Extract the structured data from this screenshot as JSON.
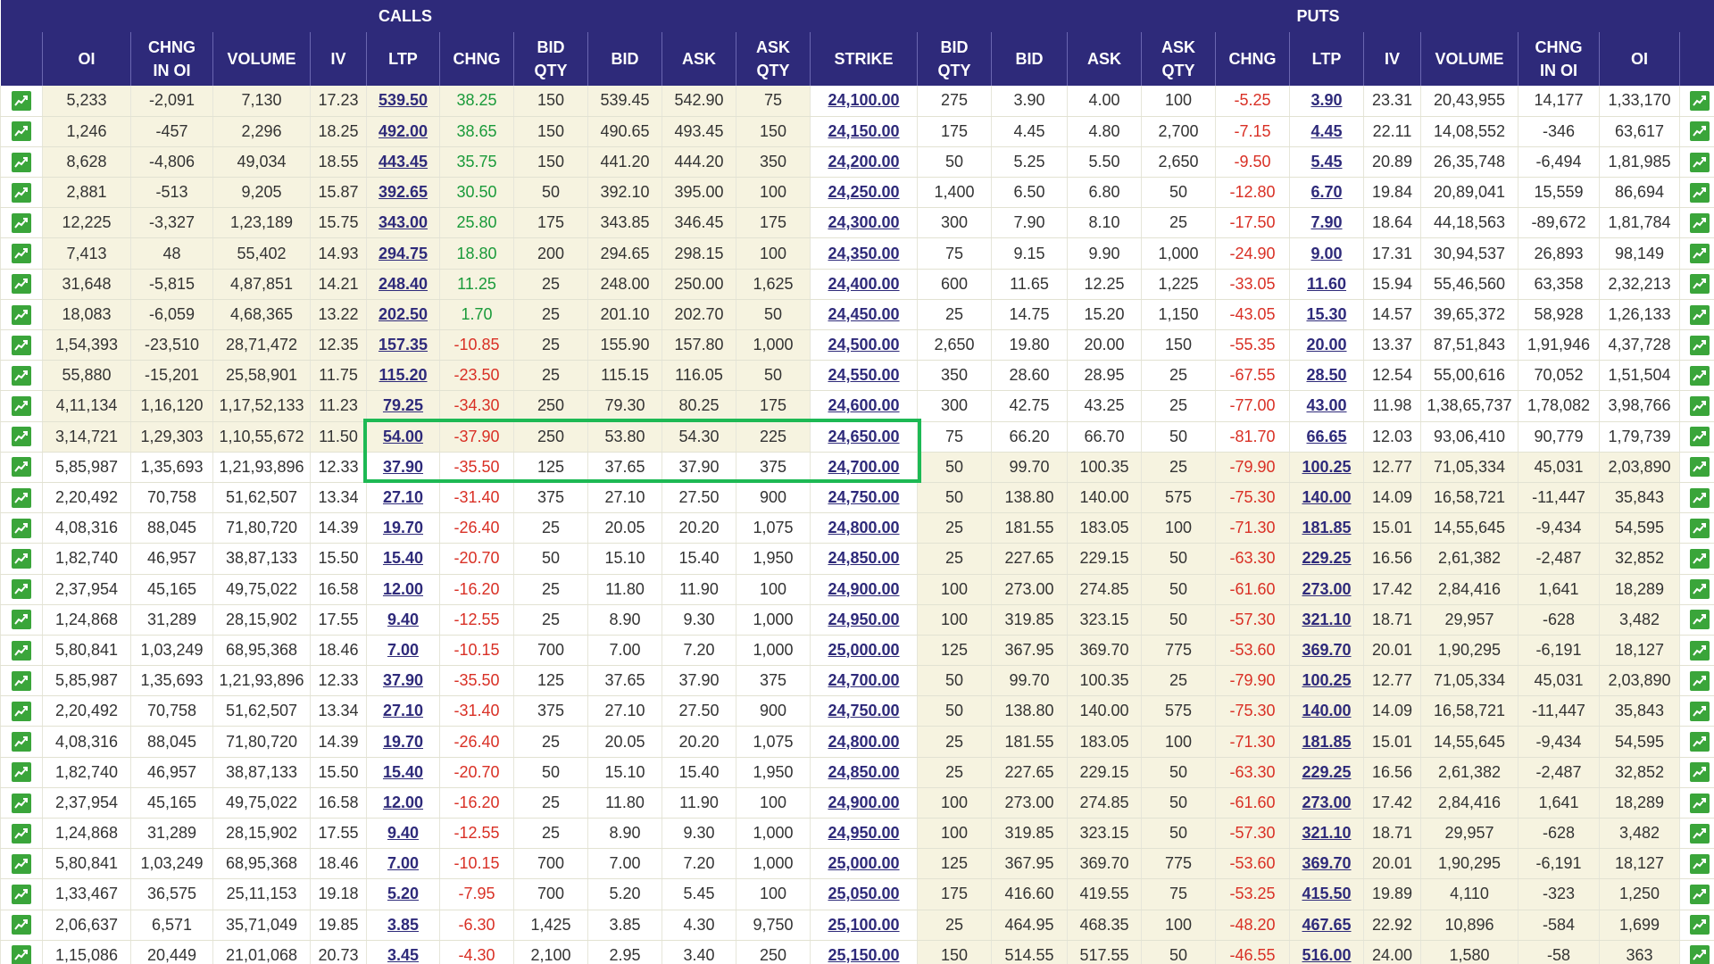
{
  "header": {
    "calls_label": "CALLS",
    "puts_label": "PUTS",
    "columns": {
      "oi": "OI",
      "chng_in_oi_1": "CHNG",
      "chng_in_oi_2": "IN OI",
      "volume": "VOLUME",
      "iv": "IV",
      "ltp": "LTP",
      "chng": "CHNG",
      "bid_qty_1": "BID",
      "bid_qty_2": "QTY",
      "bid": "BID",
      "ask": "ASK",
      "ask_qty_1": "ASK",
      "ask_qty_2": "QTY",
      "strike": "STRIKE"
    }
  },
  "icons": {
    "chart": "line-chart-icon"
  },
  "colors": {
    "header_bg": "#2e2a7a",
    "itm_bg": "#f6f3e0",
    "positive": "#1a9a3a",
    "negative": "#d93025",
    "highlight": "#1db954",
    "chart_btn": "#3aa53a"
  },
  "highlight": {
    "description": "green rectangle around rows at strikes 24,650.00 and 24,700.00"
  },
  "rows": [
    {
      "c_oi": "5,233",
      "c_chngoi": "-2,091",
      "c_vol": "7,130",
      "c_iv": "17.23",
      "c_ltp": "539.50",
      "c_chng": "38.25",
      "c_bqty": "150",
      "c_bid": "539.45",
      "c_ask": "542.90",
      "c_aqty": "75",
      "strike": "24,100.00",
      "p_bqty": "275",
      "p_bid": "3.90",
      "p_ask": "4.00",
      "p_aqty": "100",
      "p_chng": "-5.25",
      "p_ltp": "3.90",
      "p_iv": "23.31",
      "p_vol": "20,43,955",
      "p_chngoi": "14,177",
      "p_oi": "1,33,170",
      "call_itm": true
    },
    {
      "c_oi": "1,246",
      "c_chngoi": "-457",
      "c_vol": "2,296",
      "c_iv": "18.25",
      "c_ltp": "492.00",
      "c_chng": "38.65",
      "c_bqty": "150",
      "c_bid": "490.65",
      "c_ask": "493.45",
      "c_aqty": "150",
      "strike": "24,150.00",
      "p_bqty": "175",
      "p_bid": "4.45",
      "p_ask": "4.80",
      "p_aqty": "2,700",
      "p_chng": "-7.15",
      "p_ltp": "4.45",
      "p_iv": "22.11",
      "p_vol": "14,08,552",
      "p_chngoi": "-346",
      "p_oi": "63,617",
      "call_itm": true
    },
    {
      "c_oi": "8,628",
      "c_chngoi": "-4,806",
      "c_vol": "49,034",
      "c_iv": "18.55",
      "c_ltp": "443.45",
      "c_chng": "35.75",
      "c_bqty": "150",
      "c_bid": "441.20",
      "c_ask": "444.20",
      "c_aqty": "350",
      "strike": "24,200.00",
      "p_bqty": "50",
      "p_bid": "5.25",
      "p_ask": "5.50",
      "p_aqty": "2,650",
      "p_chng": "-9.50",
      "p_ltp": "5.45",
      "p_iv": "20.89",
      "p_vol": "26,35,748",
      "p_chngoi": "-6,494",
      "p_oi": "1,81,985",
      "call_itm": true
    },
    {
      "c_oi": "2,881",
      "c_chngoi": "-513",
      "c_vol": "9,205",
      "c_iv": "15.87",
      "c_ltp": "392.65",
      "c_chng": "30.50",
      "c_bqty": "50",
      "c_bid": "392.10",
      "c_ask": "395.00",
      "c_aqty": "100",
      "strike": "24,250.00",
      "p_bqty": "1,400",
      "p_bid": "6.50",
      "p_ask": "6.80",
      "p_aqty": "50",
      "p_chng": "-12.80",
      "p_ltp": "6.70",
      "p_iv": "19.84",
      "p_vol": "20,89,041",
      "p_chngoi": "15,559",
      "p_oi": "86,694",
      "call_itm": true
    },
    {
      "c_oi": "12,225",
      "c_chngoi": "-3,327",
      "c_vol": "1,23,189",
      "c_iv": "15.75",
      "c_ltp": "343.00",
      "c_chng": "25.80",
      "c_bqty": "175",
      "c_bid": "343.85",
      "c_ask": "346.45",
      "c_aqty": "175",
      "strike": "24,300.00",
      "p_bqty": "300",
      "p_bid": "7.90",
      "p_ask": "8.10",
      "p_aqty": "25",
      "p_chng": "-17.50",
      "p_ltp": "7.90",
      "p_iv": "18.64",
      "p_vol": "44,18,563",
      "p_chngoi": "-89,672",
      "p_oi": "1,81,784",
      "call_itm": true
    },
    {
      "c_oi": "7,413",
      "c_chngoi": "48",
      "c_vol": "55,402",
      "c_iv": "14.93",
      "c_ltp": "294.75",
      "c_chng": "18.80",
      "c_bqty": "200",
      "c_bid": "294.65",
      "c_ask": "298.15",
      "c_aqty": "100",
      "strike": "24,350.00",
      "p_bqty": "75",
      "p_bid": "9.15",
      "p_ask": "9.90",
      "p_aqty": "1,000",
      "p_chng": "-24.90",
      "p_ltp": "9.00",
      "p_iv": "17.31",
      "p_vol": "30,94,537",
      "p_chngoi": "26,893",
      "p_oi": "98,149",
      "call_itm": true
    },
    {
      "c_oi": "31,648",
      "c_chngoi": "-5,815",
      "c_vol": "4,87,851",
      "c_iv": "14.21",
      "c_ltp": "248.40",
      "c_chng": "11.25",
      "c_bqty": "25",
      "c_bid": "248.00",
      "c_ask": "250.00",
      "c_aqty": "1,625",
      "strike": "24,400.00",
      "p_bqty": "600",
      "p_bid": "11.65",
      "p_ask": "12.25",
      "p_aqty": "1,225",
      "p_chng": "-33.05",
      "p_ltp": "11.60",
      "p_iv": "15.94",
      "p_vol": "55,46,560",
      "p_chngoi": "63,358",
      "p_oi": "2,32,213",
      "call_itm": true
    },
    {
      "c_oi": "18,083",
      "c_chngoi": "-6,059",
      "c_vol": "4,68,365",
      "c_iv": "13.22",
      "c_ltp": "202.50",
      "c_chng": "1.70",
      "c_bqty": "25",
      "c_bid": "201.10",
      "c_ask": "202.70",
      "c_aqty": "50",
      "strike": "24,450.00",
      "p_bqty": "25",
      "p_bid": "14.75",
      "p_ask": "15.20",
      "p_aqty": "1,150",
      "p_chng": "-43.05",
      "p_ltp": "15.30",
      "p_iv": "14.57",
      "p_vol": "39,65,372",
      "p_chngoi": "58,928",
      "p_oi": "1,26,133",
      "call_itm": true
    },
    {
      "c_oi": "1,54,393",
      "c_chngoi": "-23,510",
      "c_vol": "28,71,472",
      "c_iv": "12.35",
      "c_ltp": "157.35",
      "c_chng": "-10.85",
      "c_bqty": "25",
      "c_bid": "155.90",
      "c_ask": "157.80",
      "c_aqty": "1,000",
      "strike": "24,500.00",
      "p_bqty": "2,650",
      "p_bid": "19.80",
      "p_ask": "20.00",
      "p_aqty": "150",
      "p_chng": "-55.35",
      "p_ltp": "20.00",
      "p_iv": "13.37",
      "p_vol": "87,51,843",
      "p_chngoi": "1,91,946",
      "p_oi": "4,37,728",
      "call_itm": true
    },
    {
      "c_oi": "55,880",
      "c_chngoi": "-15,201",
      "c_vol": "25,58,901",
      "c_iv": "11.75",
      "c_ltp": "115.20",
      "c_chng": "-23.50",
      "c_bqty": "25",
      "c_bid": "115.15",
      "c_ask": "116.05",
      "c_aqty": "50",
      "strike": "24,550.00",
      "p_bqty": "350",
      "p_bid": "28.60",
      "p_ask": "28.95",
      "p_aqty": "25",
      "p_chng": "-67.55",
      "p_ltp": "28.50",
      "p_iv": "12.54",
      "p_vol": "55,00,616",
      "p_chngoi": "70,052",
      "p_oi": "1,51,504",
      "call_itm": true
    },
    {
      "c_oi": "4,11,134",
      "c_chngoi": "1,16,120",
      "c_vol": "1,17,52,133",
      "c_iv": "11.23",
      "c_ltp": "79.25",
      "c_chng": "-34.30",
      "c_bqty": "250",
      "c_bid": "79.30",
      "c_ask": "80.25",
      "c_aqty": "175",
      "strike": "24,600.00",
      "p_bqty": "300",
      "p_bid": "42.75",
      "p_ask": "43.25",
      "p_aqty": "25",
      "p_chng": "-77.00",
      "p_ltp": "43.00",
      "p_iv": "11.98",
      "p_vol": "1,38,65,737",
      "p_chngoi": "1,78,082",
      "p_oi": "3,98,766",
      "call_itm": true
    },
    {
      "c_oi": "3,14,721",
      "c_chngoi": "1,29,303",
      "c_vol": "1,10,55,672",
      "c_iv": "11.50",
      "c_ltp": "54.00",
      "c_chng": "-37.90",
      "c_bqty": "250",
      "c_bid": "53.80",
      "c_ask": "54.30",
      "c_aqty": "225",
      "strike": "24,650.00",
      "p_bqty": "75",
      "p_bid": "66.20",
      "p_ask": "66.70",
      "p_aqty": "50",
      "p_chng": "-81.70",
      "p_ltp": "66.65",
      "p_iv": "12.03",
      "p_vol": "93,06,410",
      "p_chngoi": "90,779",
      "p_oi": "1,79,739",
      "call_itm": true
    },
    {
      "c_oi": "5,85,987",
      "c_chngoi": "1,35,693",
      "c_vol": "1,21,93,896",
      "c_iv": "12.33",
      "c_ltp": "37.90",
      "c_chng": "-35.50",
      "c_bqty": "125",
      "c_bid": "37.65",
      "c_ask": "37.90",
      "c_aqty": "375",
      "strike": "24,700.00",
      "p_bqty": "50",
      "p_bid": "99.70",
      "p_ask": "100.35",
      "p_aqty": "25",
      "p_chng": "-79.90",
      "p_ltp": "100.25",
      "p_iv": "12.77",
      "p_vol": "71,05,334",
      "p_chngoi": "45,031",
      "p_oi": "2,03,890",
      "call_itm": false
    },
    {
      "c_oi": "2,20,492",
      "c_chngoi": "70,758",
      "c_vol": "51,62,507",
      "c_iv": "13.34",
      "c_ltp": "27.10",
      "c_chng": "-31.40",
      "c_bqty": "375",
      "c_bid": "27.10",
      "c_ask": "27.50",
      "c_aqty": "900",
      "strike": "24,750.00",
      "p_bqty": "50",
      "p_bid": "138.80",
      "p_ask": "140.00",
      "p_aqty": "575",
      "p_chng": "-75.30",
      "p_ltp": "140.00",
      "p_iv": "14.09",
      "p_vol": "16,58,721",
      "p_chngoi": "-11,447",
      "p_oi": "35,843",
      "call_itm": false
    },
    {
      "c_oi": "4,08,316",
      "c_chngoi": "88,045",
      "c_vol": "71,80,720",
      "c_iv": "14.39",
      "c_ltp": "19.70",
      "c_chng": "-26.40",
      "c_bqty": "25",
      "c_bid": "20.05",
      "c_ask": "20.20",
      "c_aqty": "1,075",
      "strike": "24,800.00",
      "p_bqty": "25",
      "p_bid": "181.55",
      "p_ask": "183.05",
      "p_aqty": "100",
      "p_chng": "-71.30",
      "p_ltp": "181.85",
      "p_iv": "15.01",
      "p_vol": "14,55,645",
      "p_chngoi": "-9,434",
      "p_oi": "54,595",
      "call_itm": false
    },
    {
      "c_oi": "1,82,740",
      "c_chngoi": "46,957",
      "c_vol": "38,87,133",
      "c_iv": "15.50",
      "c_ltp": "15.40",
      "c_chng": "-20.70",
      "c_bqty": "50",
      "c_bid": "15.10",
      "c_ask": "15.40",
      "c_aqty": "1,950",
      "strike": "24,850.00",
      "p_bqty": "25",
      "p_bid": "227.65",
      "p_ask": "229.15",
      "p_aqty": "50",
      "p_chng": "-63.30",
      "p_ltp": "229.25",
      "p_iv": "16.56",
      "p_vol": "2,61,382",
      "p_chngoi": "-2,487",
      "p_oi": "32,852",
      "call_itm": false
    },
    {
      "c_oi": "2,37,954",
      "c_chngoi": "45,165",
      "c_vol": "49,75,022",
      "c_iv": "16.58",
      "c_ltp": "12.00",
      "c_chng": "-16.20",
      "c_bqty": "25",
      "c_bid": "11.80",
      "c_ask": "11.90",
      "c_aqty": "100",
      "strike": "24,900.00",
      "p_bqty": "100",
      "p_bid": "273.00",
      "p_ask": "274.85",
      "p_aqty": "50",
      "p_chng": "-61.60",
      "p_ltp": "273.00",
      "p_iv": "17.42",
      "p_vol": "2,84,416",
      "p_chngoi": "1,641",
      "p_oi": "18,289",
      "call_itm": false
    },
    {
      "c_oi": "1,24,868",
      "c_chngoi": "31,289",
      "c_vol": "28,15,902",
      "c_iv": "17.55",
      "c_ltp": "9.40",
      "c_chng": "-12.55",
      "c_bqty": "25",
      "c_bid": "8.90",
      "c_ask": "9.30",
      "c_aqty": "1,000",
      "strike": "24,950.00",
      "p_bqty": "100",
      "p_bid": "319.85",
      "p_ask": "323.15",
      "p_aqty": "50",
      "p_chng": "-57.30",
      "p_ltp": "321.10",
      "p_iv": "18.71",
      "p_vol": "29,957",
      "p_chngoi": "-628",
      "p_oi": "3,482",
      "call_itm": false
    },
    {
      "c_oi": "5,80,841",
      "c_chngoi": "1,03,249",
      "c_vol": "68,95,368",
      "c_iv": "18.46",
      "c_ltp": "7.00",
      "c_chng": "-10.15",
      "c_bqty": "700",
      "c_bid": "7.00",
      "c_ask": "7.20",
      "c_aqty": "1,000",
      "strike": "25,000.00",
      "p_bqty": "125",
      "p_bid": "367.95",
      "p_ask": "369.70",
      "p_aqty": "775",
      "p_chng": "-53.60",
      "p_ltp": "369.70",
      "p_iv": "20.01",
      "p_vol": "1,90,295",
      "p_chngoi": "-6,191",
      "p_oi": "18,127",
      "call_itm": false
    },
    {
      "c_oi": "5,85,987",
      "c_chngoi": "1,35,693",
      "c_vol": "1,21,93,896",
      "c_iv": "12.33",
      "c_ltp": "37.90",
      "c_chng": "-35.50",
      "c_bqty": "125",
      "c_bid": "37.65",
      "c_ask": "37.90",
      "c_aqty": "375",
      "strike": "24,700.00",
      "p_bqty": "50",
      "p_bid": "99.70",
      "p_ask": "100.35",
      "p_aqty": "25",
      "p_chng": "-79.90",
      "p_ltp": "100.25",
      "p_iv": "12.77",
      "p_vol": "71,05,334",
      "p_chngoi": "45,031",
      "p_oi": "2,03,890",
      "call_itm": false
    },
    {
      "c_oi": "2,20,492",
      "c_chngoi": "70,758",
      "c_vol": "51,62,507",
      "c_iv": "13.34",
      "c_ltp": "27.10",
      "c_chng": "-31.40",
      "c_bqty": "375",
      "c_bid": "27.10",
      "c_ask": "27.50",
      "c_aqty": "900",
      "strike": "24,750.00",
      "p_bqty": "50",
      "p_bid": "138.80",
      "p_ask": "140.00",
      "p_aqty": "575",
      "p_chng": "-75.30",
      "p_ltp": "140.00",
      "p_iv": "14.09",
      "p_vol": "16,58,721",
      "p_chngoi": "-11,447",
      "p_oi": "35,843",
      "call_itm": false
    },
    {
      "c_oi": "4,08,316",
      "c_chngoi": "88,045",
      "c_vol": "71,80,720",
      "c_iv": "14.39",
      "c_ltp": "19.70",
      "c_chng": "-26.40",
      "c_bqty": "25",
      "c_bid": "20.05",
      "c_ask": "20.20",
      "c_aqty": "1,075",
      "strike": "24,800.00",
      "p_bqty": "25",
      "p_bid": "181.55",
      "p_ask": "183.05",
      "p_aqty": "100",
      "p_chng": "-71.30",
      "p_ltp": "181.85",
      "p_iv": "15.01",
      "p_vol": "14,55,645",
      "p_chngoi": "-9,434",
      "p_oi": "54,595",
      "call_itm": false
    },
    {
      "c_oi": "1,82,740",
      "c_chngoi": "46,957",
      "c_vol": "38,87,133",
      "c_iv": "15.50",
      "c_ltp": "15.40",
      "c_chng": "-20.70",
      "c_bqty": "50",
      "c_bid": "15.10",
      "c_ask": "15.40",
      "c_aqty": "1,950",
      "strike": "24,850.00",
      "p_bqty": "25",
      "p_bid": "227.65",
      "p_ask": "229.15",
      "p_aqty": "50",
      "p_chng": "-63.30",
      "p_ltp": "229.25",
      "p_iv": "16.56",
      "p_vol": "2,61,382",
      "p_chngoi": "-2,487",
      "p_oi": "32,852",
      "call_itm": false
    },
    {
      "c_oi": "2,37,954",
      "c_chngoi": "45,165",
      "c_vol": "49,75,022",
      "c_iv": "16.58",
      "c_ltp": "12.00",
      "c_chng": "-16.20",
      "c_bqty": "25",
      "c_bid": "11.80",
      "c_ask": "11.90",
      "c_aqty": "100",
      "strike": "24,900.00",
      "p_bqty": "100",
      "p_bid": "273.00",
      "p_ask": "274.85",
      "p_aqty": "50",
      "p_chng": "-61.60",
      "p_ltp": "273.00",
      "p_iv": "17.42",
      "p_vol": "2,84,416",
      "p_chngoi": "1,641",
      "p_oi": "18,289",
      "call_itm": false
    },
    {
      "c_oi": "1,24,868",
      "c_chngoi": "31,289",
      "c_vol": "28,15,902",
      "c_iv": "17.55",
      "c_ltp": "9.40",
      "c_chng": "-12.55",
      "c_bqty": "25",
      "c_bid": "8.90",
      "c_ask": "9.30",
      "c_aqty": "1,000",
      "strike": "24,950.00",
      "p_bqty": "100",
      "p_bid": "319.85",
      "p_ask": "323.15",
      "p_aqty": "50",
      "p_chng": "-57.30",
      "p_ltp": "321.10",
      "p_iv": "18.71",
      "p_vol": "29,957",
      "p_chngoi": "-628",
      "p_oi": "3,482",
      "call_itm": false
    },
    {
      "c_oi": "5,80,841",
      "c_chngoi": "1,03,249",
      "c_vol": "68,95,368",
      "c_iv": "18.46",
      "c_ltp": "7.00",
      "c_chng": "-10.15",
      "c_bqty": "700",
      "c_bid": "7.00",
      "c_ask": "7.20",
      "c_aqty": "1,000",
      "strike": "25,000.00",
      "p_bqty": "125",
      "p_bid": "367.95",
      "p_ask": "369.70",
      "p_aqty": "775",
      "p_chng": "-53.60",
      "p_ltp": "369.70",
      "p_iv": "20.01",
      "p_vol": "1,90,295",
      "p_chngoi": "-6,191",
      "p_oi": "18,127",
      "call_itm": false
    },
    {
      "c_oi": "1,33,467",
      "c_chngoi": "36,575",
      "c_vol": "25,11,153",
      "c_iv": "19.18",
      "c_ltp": "5.20",
      "c_chng": "-7.95",
      "c_bqty": "700",
      "c_bid": "5.20",
      "c_ask": "5.45",
      "c_aqty": "100",
      "strike": "25,050.00",
      "p_bqty": "175",
      "p_bid": "416.60",
      "p_ask": "419.55",
      "p_aqty": "75",
      "p_chng": "-53.25",
      "p_ltp": "415.50",
      "p_iv": "19.89",
      "p_vol": "4,110",
      "p_chngoi": "-323",
      "p_oi": "1,250",
      "call_itm": false
    },
    {
      "c_oi": "2,06,637",
      "c_chngoi": "6,571",
      "c_vol": "35,71,049",
      "c_iv": "19.85",
      "c_ltp": "3.85",
      "c_chng": "-6.30",
      "c_bqty": "1,425",
      "c_bid": "3.85",
      "c_ask": "4.30",
      "c_aqty": "9,750",
      "strike": "25,100.00",
      "p_bqty": "25",
      "p_bid": "464.95",
      "p_ask": "468.35",
      "p_aqty": "100",
      "p_chng": "-48.20",
      "p_ltp": "467.65",
      "p_iv": "22.92",
      "p_vol": "10,896",
      "p_chngoi": "-584",
      "p_oi": "1,699",
      "call_itm": false
    },
    {
      "c_oi": "1,15,086",
      "c_chngoi": "20,449",
      "c_vol": "21,01,068",
      "c_iv": "20.73",
      "c_ltp": "3.45",
      "c_chng": "-4.30",
      "c_bqty": "2,100",
      "c_bid": "2.95",
      "c_ask": "3.40",
      "c_aqty": "250",
      "strike": "25,150.00",
      "p_bqty": "150",
      "p_bid": "514.55",
      "p_ask": "517.55",
      "p_aqty": "50",
      "p_chng": "-46.55",
      "p_ltp": "516.00",
      "p_iv": "24.00",
      "p_vol": "1,580",
      "p_chngoi": "-58",
      "p_oi": "363",
      "call_itm": false
    }
  ]
}
